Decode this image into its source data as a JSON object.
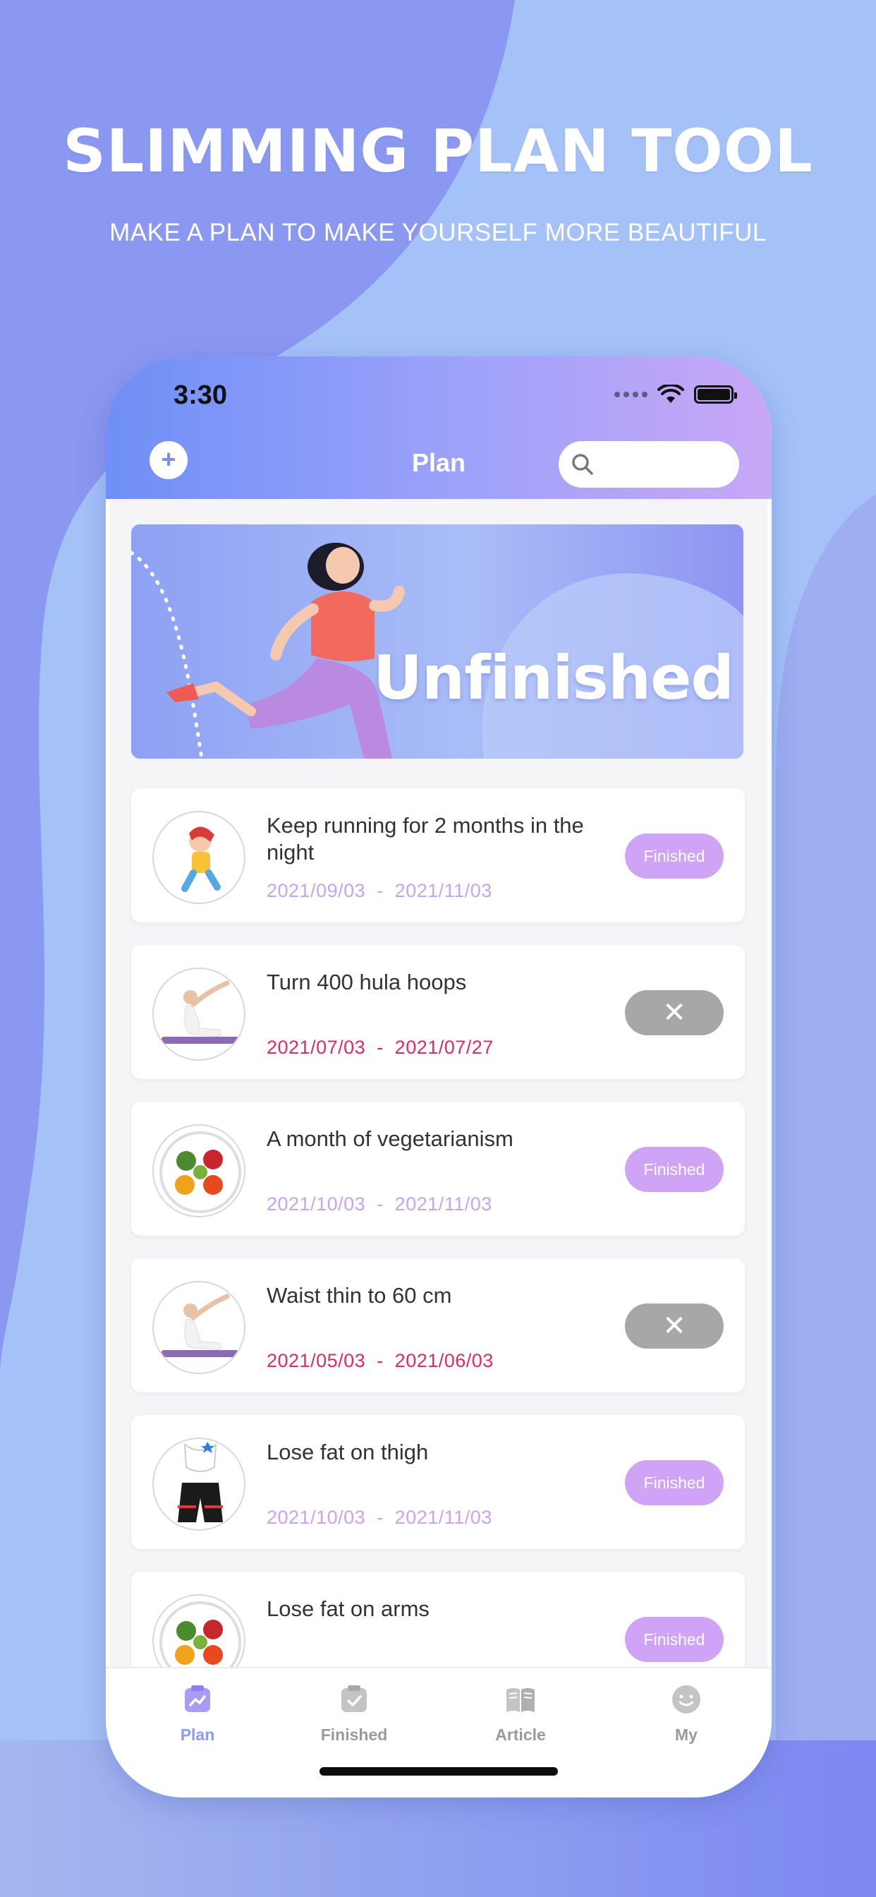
{
  "promo": {
    "headline": "SLIMMING PLAN TOOL",
    "subline": "MAKE A PLAN TO MAKE YOURSELF MORE BEAUTIFUL"
  },
  "status_bar": {
    "time": "3:30"
  },
  "header": {
    "add_icon": "plus-icon",
    "title": "Plan",
    "search_placeholder": ""
  },
  "banner": {
    "text": "Unfinished"
  },
  "plans": [
    {
      "title": "Keep running for 2 months in the night",
      "start": "2021/09/03",
      "end": "2021/11/03",
      "status": "Finished",
      "state": "finished"
    },
    {
      "title": "Turn 400 hula hoops",
      "start": "2021/07/03",
      "end": "2021/07/27",
      "status": "✕",
      "state": "cancel"
    },
    {
      "title": "A month of vegetarianism",
      "start": "2021/10/03",
      "end": "2021/11/03",
      "status": "Finished",
      "state": "finished"
    },
    {
      "title": "Waist thin to 60 cm",
      "start": "2021/05/03",
      "end": "2021/06/03",
      "status": "✕",
      "state": "cancel"
    },
    {
      "title": "Lose fat on thigh",
      "start": "2021/10/03",
      "end": "2021/11/03",
      "status": "Finished",
      "state": "finished"
    },
    {
      "title": "Lose fat on arms",
      "status": "Finished",
      "state": "finished"
    }
  ],
  "date_separator": "-",
  "tabs": [
    {
      "label": "Plan",
      "icon": "plan-icon",
      "active": true
    },
    {
      "label": "Finished",
      "icon": "clipboard-check-icon",
      "active": false
    },
    {
      "label": "Article",
      "icon": "book-icon",
      "active": false
    },
    {
      "label": "My",
      "icon": "smiley-icon",
      "active": false
    }
  ],
  "colors": {
    "accent_purple": "#cfa4f6",
    "date_purple": "#c9a3f2",
    "date_red": "#e5295f",
    "tab_active": "#8a9af5",
    "cancel_gray": "#a7a7a7"
  }
}
